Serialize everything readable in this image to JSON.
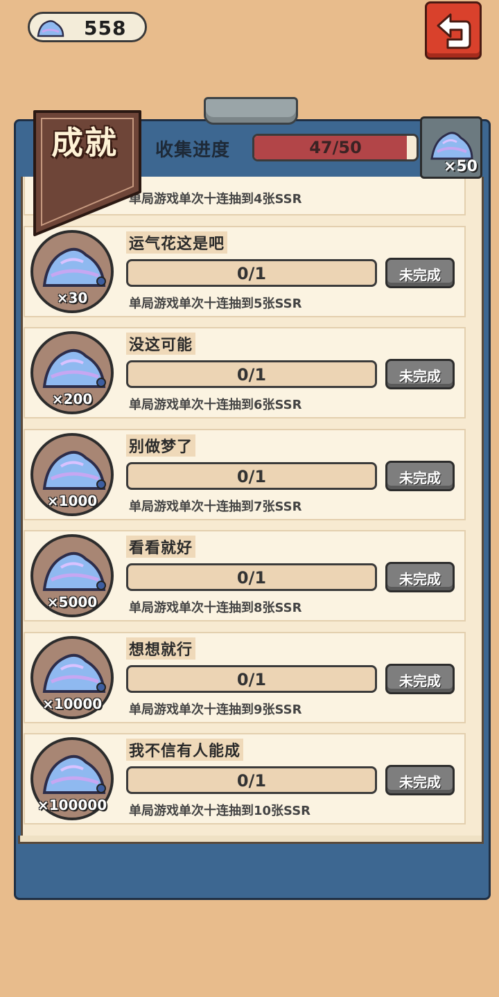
{
  "currency": {
    "amount": "558",
    "icon": "crystal-icon"
  },
  "back_button": {
    "icon": "return-arrow-icon"
  },
  "header": {
    "title": "成就",
    "progress_label": "收集进度",
    "progress_text": "47/50",
    "progress_fraction": 0.94,
    "reward_qty": "×50"
  },
  "partial_row": {
    "desc": "单局游戏单次十连抽到4张SSR"
  },
  "achievements": [
    {
      "name": "运气花这是吧",
      "reward": "×30",
      "progress": "0/1",
      "status": "未完成",
      "desc": "单局游戏单次十连抽到5张SSR"
    },
    {
      "name": "没这可能",
      "reward": "×200",
      "progress": "0/1",
      "status": "未完成",
      "desc": "单局游戏单次十连抽到6张SSR"
    },
    {
      "name": "别做梦了",
      "reward": "×1000",
      "progress": "0/1",
      "status": "未完成",
      "desc": "单局游戏单次十连抽到7张SSR"
    },
    {
      "name": "看看就好",
      "reward": "×5000",
      "progress": "0/1",
      "status": "未完成",
      "desc": "单局游戏单次十连抽到8张SSR"
    },
    {
      "name": "想想就行",
      "reward": "×10000",
      "progress": "0/1",
      "status": "未完成",
      "desc": "单局游戏单次十连抽到9张SSR"
    },
    {
      "name": "我不信有人能成",
      "reward": "×100000",
      "progress": "0/1",
      "status": "未完成",
      "desc": "单局游戏单次十连抽到10张SSR"
    }
  ],
  "colors": {
    "background": "#e8bc8c",
    "board": "#3d6791",
    "progress_fill": "#b24548",
    "button_gray": "#7e7e7e",
    "back_red": "#d9412c"
  }
}
